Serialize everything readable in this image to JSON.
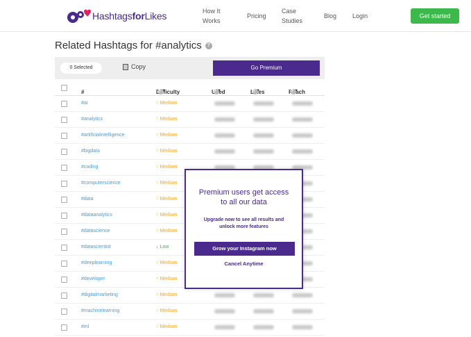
{
  "header": {
    "logo_text_regular": "Hashtags",
    "logo_text_bold": "for",
    "logo_text_end": "Likes",
    "nav": [
      {
        "line1": "How It",
        "line2": "Works"
      },
      {
        "line1": "Pricing",
        "line2": ""
      },
      {
        "line1": "Case",
        "line2": "Studies"
      },
      {
        "line1": "Blog",
        "line2": ""
      },
      {
        "line1": "Login",
        "line2": ""
      }
    ],
    "cta_label": "Get started"
  },
  "title": "Related Hashtags for #analytics",
  "toolbar": {
    "selected_label": "0 Selected",
    "copy_label": "Copy",
    "premium_label": "Go Premium"
  },
  "table": {
    "columns": {
      "hash": "#",
      "difficulty": "Difficulty",
      "used": "Used",
      "likes": "Likes",
      "reach": "Reach"
    },
    "rows": [
      {
        "tag": "#ai",
        "difficulty": "Medium",
        "level": "medium"
      },
      {
        "tag": "#analytics",
        "difficulty": "Medium",
        "level": "medium"
      },
      {
        "tag": "#artificialintelligence",
        "difficulty": "Medium",
        "level": "medium"
      },
      {
        "tag": "#bigdata",
        "difficulty": "Medium",
        "level": "medium"
      },
      {
        "tag": "#coding",
        "difficulty": "Medium",
        "level": "medium"
      },
      {
        "tag": "#computerscience",
        "difficulty": "Medium",
        "level": "medium"
      },
      {
        "tag": "#data",
        "difficulty": "Medium",
        "level": "medium"
      },
      {
        "tag": "#dataanalytics",
        "difficulty": "Medium",
        "level": "medium"
      },
      {
        "tag": "#datascience",
        "difficulty": "Medium",
        "level": "medium"
      },
      {
        "tag": "#datascientist",
        "difficulty": "Low",
        "level": "low"
      },
      {
        "tag": "#deeplearning",
        "difficulty": "Medium",
        "level": "medium"
      },
      {
        "tag": "#developer",
        "difficulty": "Medium",
        "level": "medium"
      },
      {
        "tag": "#digitalmarketing",
        "difficulty": "Medium",
        "level": "medium"
      },
      {
        "tag": "#machinelearning",
        "difficulty": "Medium",
        "level": "medium"
      },
      {
        "tag": "#ml",
        "difficulty": "Medium",
        "level": "medium"
      }
    ]
  },
  "modal": {
    "title": "Premium users get access to all our data",
    "subtitle": "Upgrade now to see all results and unlock more features",
    "button_label": "Grow your Instagram now",
    "cancel_label": "Cancel Anytime"
  },
  "colors": {
    "brand": "#4a2a8c",
    "cta_green": "#3db84a",
    "tag_blue": "#4a9bd9",
    "medium_orange": "#f5a623",
    "low_green": "#3db84a"
  }
}
